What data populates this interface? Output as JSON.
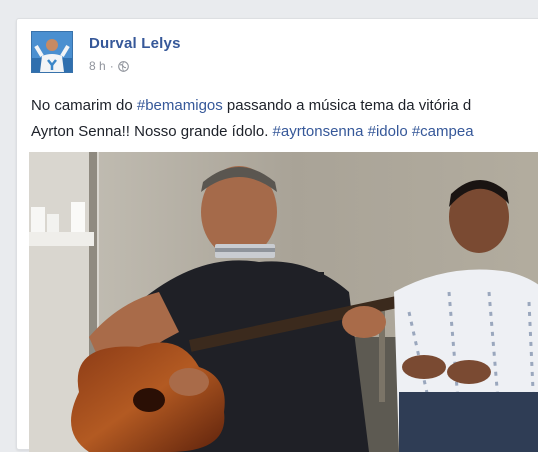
{
  "post": {
    "author": "Durval Lelys",
    "time": "8 h",
    "separator": "·",
    "privacy_icon": "globe-icon",
    "text": {
      "line1_before": "No camarim do ",
      "hashtag1": "#bemamigos",
      "line1_after": " passando a música tema da vitória d",
      "line2_before": "Ayrton Senna!! Nosso grande ídolo. ",
      "hashtag2": "#ayrtonsenna",
      "hashtag3": "#idolo",
      "hashtag4": "#campea"
    }
  },
  "colors": {
    "link": "#365899",
    "text": "#1d2129",
    "meta": "#90949c",
    "background": "#e9ebee"
  }
}
